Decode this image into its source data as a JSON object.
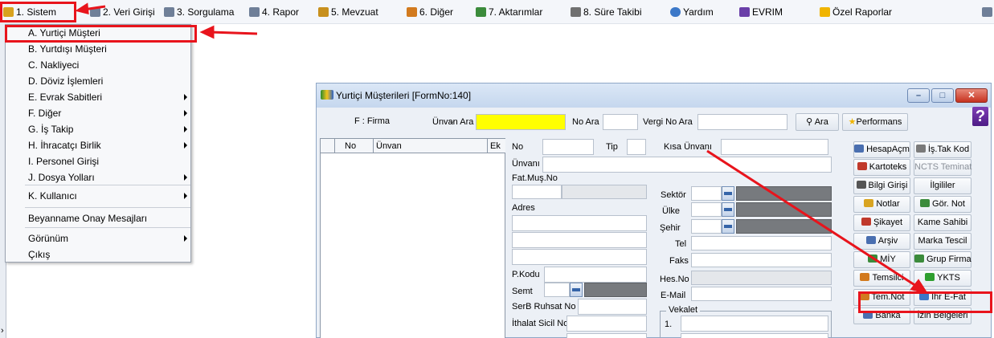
{
  "menubar": {
    "items": [
      {
        "label": "1. Sistem",
        "icon": "system-icon",
        "color": "#d8a21e"
      },
      {
        "label": "2. Veri Girişi",
        "icon": "data-entry-icon",
        "color": "#6f7f98"
      },
      {
        "label": "3. Sorgulama",
        "icon": "query-icon",
        "color": "#6f7f98"
      },
      {
        "label": "4. Rapor",
        "icon": "report-icon",
        "color": "#6f7f98"
      },
      {
        "label": "5. Mevzuat",
        "icon": "legislation-icon",
        "color": "#c8901d"
      },
      {
        "label": "6. Diğer",
        "icon": "other-icon",
        "color": "#d27a1e"
      },
      {
        "label": "7. Aktarımlar",
        "icon": "transfer-icon",
        "color": "#3b8b3b"
      },
      {
        "label": "8. Süre Takibi",
        "icon": "calendar-icon",
        "color": "#707070"
      },
      {
        "label": "Yardım",
        "icon": "help-icon",
        "color": "#3c78c8"
      },
      {
        "label": "EVRIM",
        "icon": "evrim-icon",
        "color": "#6a3fa8"
      },
      {
        "label": "Özel Raporlar",
        "icon": "star-icon",
        "color": "#f0b400"
      }
    ]
  },
  "dropdown": {
    "items": [
      {
        "label": "A.  Yurtiçi Müşteri",
        "submenu": false
      },
      {
        "label": "B.  Yurtdışı Müşteri",
        "submenu": false
      },
      {
        "label": "C.  Nakliyeci",
        "submenu": false
      },
      {
        "label": "D.  Döviz İşlemleri",
        "submenu": false
      },
      {
        "label": "E.  Evrak Sabitleri",
        "submenu": true
      },
      {
        "label": "F.  Diğer",
        "submenu": true
      },
      {
        "label": "G.  İş Takip",
        "submenu": true
      },
      {
        "label": "H.  İhracatçı Birlik",
        "submenu": true
      },
      {
        "label": "I.   Personel Girişi",
        "submenu": false
      },
      {
        "label": "J.  Dosya Yolları",
        "submenu": true
      },
      {
        "label": "K.  Kullanıcı",
        "submenu": true
      },
      {
        "label": "Beyanname Onay Mesajları",
        "submenu": false
      },
      {
        "label": "Görünüm",
        "submenu": true
      },
      {
        "label": "Çıkış",
        "submenu": false
      }
    ]
  },
  "form": {
    "title": "Yurtiçi Müşterileri [FormNo:140]",
    "search": {
      "type_select": "F : Firma",
      "unvan_ara_label": "Ünvan Ara",
      "unvan_ara_value": "",
      "no_ara_label": "No Ara",
      "vergi_no_ara_label": "Vergi No Ara",
      "ara_button": "Ara",
      "performans_button": "Performans",
      "help_glyph": "?"
    },
    "grid": {
      "headers": [
        "No",
        "Ünvan",
        "Ek"
      ]
    },
    "fields": {
      "no": "No",
      "tip": "Tip",
      "kisa_unvan": "Kısa Ünvanı",
      "unvani": "Ünvanı",
      "fat_mus_no": "Fat.Muş.No",
      "sektor": "Sektör",
      "ulke": "Ülke",
      "sehir": "Şehir",
      "adres": "Adres",
      "tel": "Tel",
      "faks": "Faks",
      "p_kodu": "P.Kodu",
      "hes_no": "Hes.No",
      "semt": "Semt",
      "e_mail": "E-Mail",
      "serb_ruhsat_no": "SerB Ruhsat No",
      "vekalet": "Vekalet",
      "ithalat_sicil_no": "İthalat Sicil No",
      "vekalet_1": "1."
    },
    "right_buttons": [
      {
        "label": "HesapAçm",
        "icon": "handshake-icon",
        "color": "#4a6fb0",
        "disabled": false
      },
      {
        "label": "İş.Tak Kod",
        "icon": "calendar-icon",
        "color": "#7a7a7a",
        "disabled": false
      },
      {
        "label": "Kartoteks",
        "icon": "card-icon",
        "color": "#c0392b",
        "disabled": false
      },
      {
        "label": "NCTS Teminat",
        "icon": "",
        "color": "",
        "disabled": true
      },
      {
        "label": "Bilgi Girişi",
        "icon": "info-icon",
        "color": "#555555",
        "disabled": false
      },
      {
        "label": "İlgililer",
        "icon": "",
        "color": "",
        "disabled": false
      },
      {
        "label": "Notlar",
        "icon": "notes-icon",
        "color": "#d9a420",
        "disabled": false
      },
      {
        "label": "Gör. Not",
        "icon": "view-note-icon",
        "color": "#3b8b3b",
        "disabled": false
      },
      {
        "label": "Şikayet",
        "icon": "complaint-icon",
        "color": "#c0392b",
        "disabled": false
      },
      {
        "label": "Kame Sahibi",
        "icon": "",
        "color": "",
        "disabled": false
      },
      {
        "label": "Arşiv",
        "icon": "archive-icon",
        "color": "#4a6fb0",
        "disabled": false
      },
      {
        "label": "Marka Tescil",
        "icon": "",
        "color": "",
        "disabled": false
      },
      {
        "label": "MİY",
        "icon": "globe-icon",
        "color": "#3b8b3b",
        "disabled": false
      },
      {
        "label": "Grup Firma",
        "icon": "group-icon",
        "color": "#3b8b3b",
        "disabled": false
      },
      {
        "label": "Temsilci",
        "icon": "agent-icon",
        "color": "#d27a1e",
        "disabled": false
      },
      {
        "label": "YKTS",
        "icon": "check-icon",
        "color": "#2e9e2e",
        "disabled": false
      },
      {
        "label": "Tem.Not",
        "icon": "agent-note-icon",
        "color": "#d27a1e",
        "disabled": false
      },
      {
        "label": "İhr E-Fat",
        "icon": "efatura-icon",
        "color": "#3c78c8",
        "disabled": false
      },
      {
        "label": "Banka",
        "icon": "bank-icon",
        "color": "#4a6fb0",
        "disabled": false
      },
      {
        "label": "İzin Belgeleri",
        "icon": "",
        "color": "",
        "disabled": false
      }
    ]
  },
  "colors": {
    "annotation_red": "#e8141c",
    "highlight_yellow": "#ffff00",
    "field_gray": "#777a7e"
  }
}
